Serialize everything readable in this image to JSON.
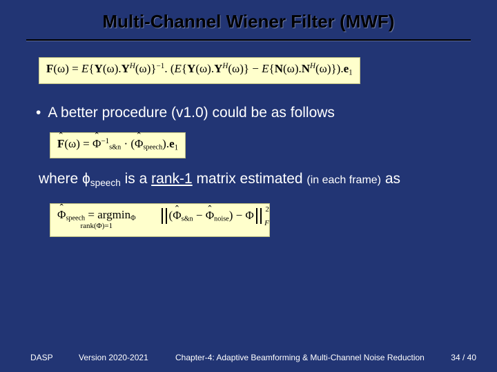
{
  "title": "Multi-Channel Wiener Filter (MWF)",
  "eq1": "F(ω) = E{Y(ω).Yᴴ(ω)}⁻¹ . (E{Y(ω).Yᴴ(ω)} − E{N(ω).Nᴴ(ω)}) . e₁",
  "bullet1": "A better procedure (v1.0) could be as follows",
  "eq2": "F̂(ω) = Φ̂⁻¹_{s&n} · (Φ̂_{speech}) . e₁",
  "where_pre": "where ",
  "where_phi": "ϕ",
  "where_phi_sub": "speech",
  "where_mid": " is a ",
  "where_rank": "rank-1",
  "where_post1": " matrix estimated ",
  "where_frame": "(in each frame)",
  "where_post2": " as",
  "eq3_left_top": "Φ̂_{speech} = argmin_Φ",
  "eq3_left_rank": "rank(Φ)=1",
  "eq3_right": "‖(Φ̂_{s&n} − Φ̂_{noise}) − Φ‖",
  "eq3_norm_F": "F",
  "eq3_norm_2": "2",
  "footer": {
    "left": "DASP",
    "version": "Version 2020-2021",
    "chapter": "Chapter-4: Adaptive Beamforming & Multi-Channel Noise Reduction",
    "page": "34 / 40"
  }
}
